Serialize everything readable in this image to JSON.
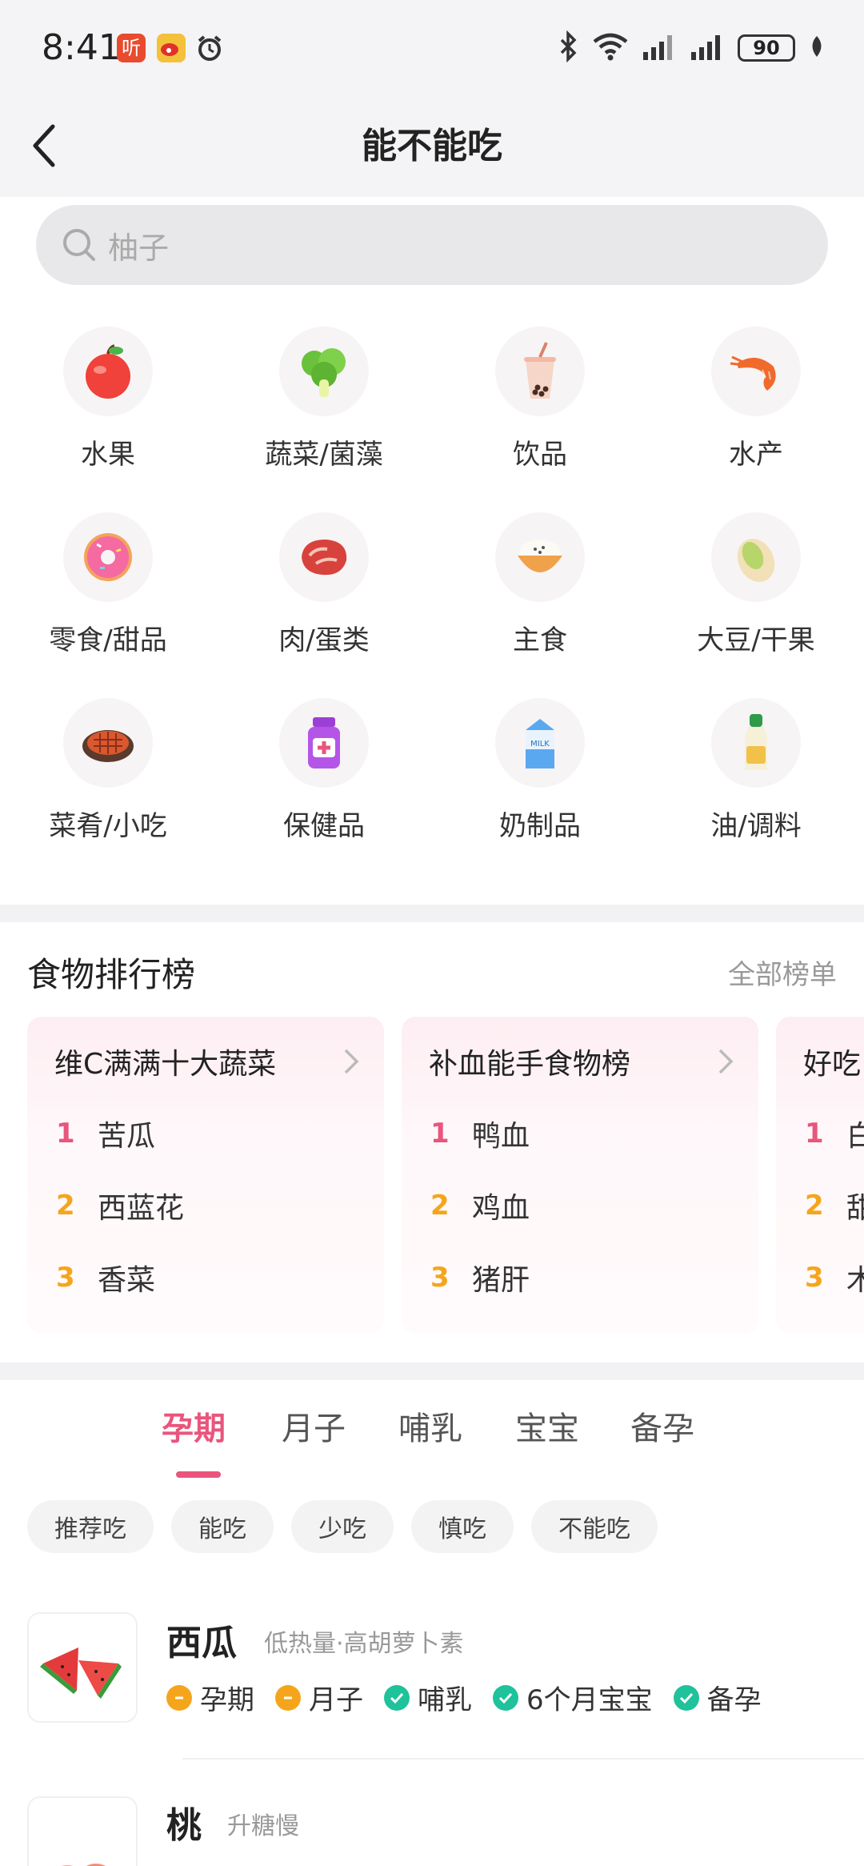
{
  "status_bar": {
    "time": "8:41",
    "app1_label": "听",
    "battery": "90"
  },
  "header": {
    "title": "能不能吃"
  },
  "search": {
    "placeholder": "柚子"
  },
  "categories": [
    {
      "label": "水果",
      "icon": "apple-icon"
    },
    {
      "label": "蔬菜/菌藻",
      "icon": "broccoli-icon"
    },
    {
      "label": "饮品",
      "icon": "bubble-tea-icon"
    },
    {
      "label": "水产",
      "icon": "shrimp-icon"
    },
    {
      "label": "零食/甜品",
      "icon": "donut-icon"
    },
    {
      "label": "肉/蛋类",
      "icon": "steak-icon"
    },
    {
      "label": "主食",
      "icon": "rice-bowl-icon"
    },
    {
      "label": "大豆/干果",
      "icon": "pistachio-icon"
    },
    {
      "label": "菜肴/小吃",
      "icon": "pan-dish-icon"
    },
    {
      "label": "保健品",
      "icon": "supplement-bottle-icon"
    },
    {
      "label": "奶制品",
      "icon": "milk-carton-icon"
    },
    {
      "label": "油/调料",
      "icon": "sauce-bottle-icon"
    }
  ],
  "rankings": {
    "title": "食物排行榜",
    "all_link": "全部榜单",
    "cards": [
      {
        "title": "维C满满十大蔬菜",
        "items": [
          "苦瓜",
          "西蓝花",
          "香菜"
        ]
      },
      {
        "title": "补血能手食物榜",
        "items": [
          "鸭血",
          "鸡血",
          "猪肝"
        ]
      },
      {
        "title": "好吃",
        "items": [
          "白",
          "甜",
          "木"
        ]
      }
    ],
    "rank_numbers": [
      "1",
      "2",
      "3"
    ]
  },
  "stage_tabs": [
    "孕期",
    "月子",
    "哺乳",
    "宝宝",
    "备孕"
  ],
  "filter_chips": [
    "推荐吃",
    "能吃",
    "少吃",
    "慎吃",
    "不能吃"
  ],
  "foods": [
    {
      "name": "西瓜",
      "desc": "低热量·高胡萝卜素",
      "tags": [
        {
          "label": "孕期",
          "status": "caution"
        },
        {
          "label": "月子",
          "status": "caution"
        },
        {
          "label": "哺乳",
          "status": "ok"
        },
        {
          "label": "6个月宝宝",
          "status": "ok"
        },
        {
          "label": "备孕",
          "status": "ok"
        }
      ]
    },
    {
      "name": "桃",
      "desc": "升糖慢",
      "tags": []
    }
  ],
  "colors": {
    "accent": "#e9557c",
    "caution": "#f5a51c",
    "ok": "#1fc29a",
    "rank1": "#e9557c",
    "rank2": "#f5a51c",
    "rank3": "#f5a51c"
  }
}
